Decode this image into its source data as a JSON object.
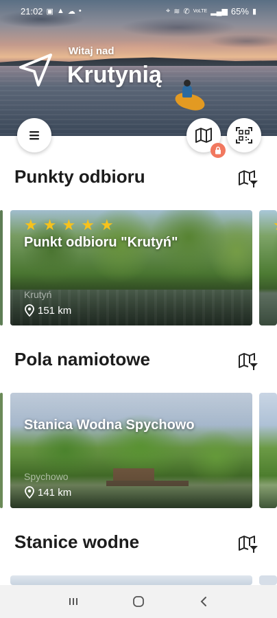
{
  "status_bar": {
    "time": "21:02",
    "battery": "65%",
    "network": "VoLTE"
  },
  "hero": {
    "greeting": "Witaj nad",
    "city": "Krutynią"
  },
  "sections": [
    {
      "title": "Punkty odbioru",
      "card": {
        "title": "Punkt odbioru \"Krutyń\"",
        "place": "Krutyń",
        "distance": "151 km",
        "rating": 5
      }
    },
    {
      "title": "Pola namiotowe",
      "card": {
        "title": "Stanica Wodna Spychowo",
        "place": "Spychowo",
        "distance": "141 km"
      }
    },
    {
      "title": "Stanice wodne"
    }
  ],
  "icons": {
    "location": "navigation-arrow-icon",
    "menu": "hamburger-icon",
    "map": "map-icon",
    "qr": "qr-scan-icon",
    "lock": "lock-icon",
    "pin": "location-pin-icon",
    "star": "star-icon"
  },
  "colors": {
    "star": "#f7c21c",
    "lock_badge": "#f1785f"
  }
}
